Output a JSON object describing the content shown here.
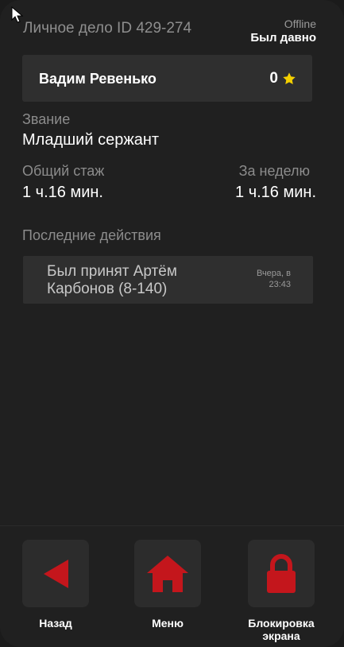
{
  "header": {
    "title": "Личное дело ID 429-274",
    "status": "Offline",
    "last_seen": "Был давно"
  },
  "profile": {
    "name": "Вадим Ревенько",
    "rating": "0"
  },
  "rank": {
    "label": "Звание",
    "value": "Младший сержант"
  },
  "stats": {
    "total_label": "Общий стаж",
    "total_value": "1 ч.16 мин.",
    "week_label": "За неделю",
    "week_value": "1 ч.16 мин."
  },
  "actions": {
    "label": "Последние действия",
    "items": [
      {
        "text": "Был принят Артём Карбонов (8-140)",
        "time_line1": "Вчера, в",
        "time_line2": "23:43"
      }
    ]
  },
  "nav": {
    "back_label": "Назад",
    "menu_label": "Меню",
    "lock_label_line1": "Блокировка",
    "lock_label_line2": "экрана"
  },
  "colors": {
    "accent_red": "#c4161c",
    "star_yellow": "#f4d000"
  },
  "icons": {
    "back": "back-triangle-icon",
    "menu": "home-icon",
    "lock": "lock-icon",
    "rating": "star-icon"
  }
}
